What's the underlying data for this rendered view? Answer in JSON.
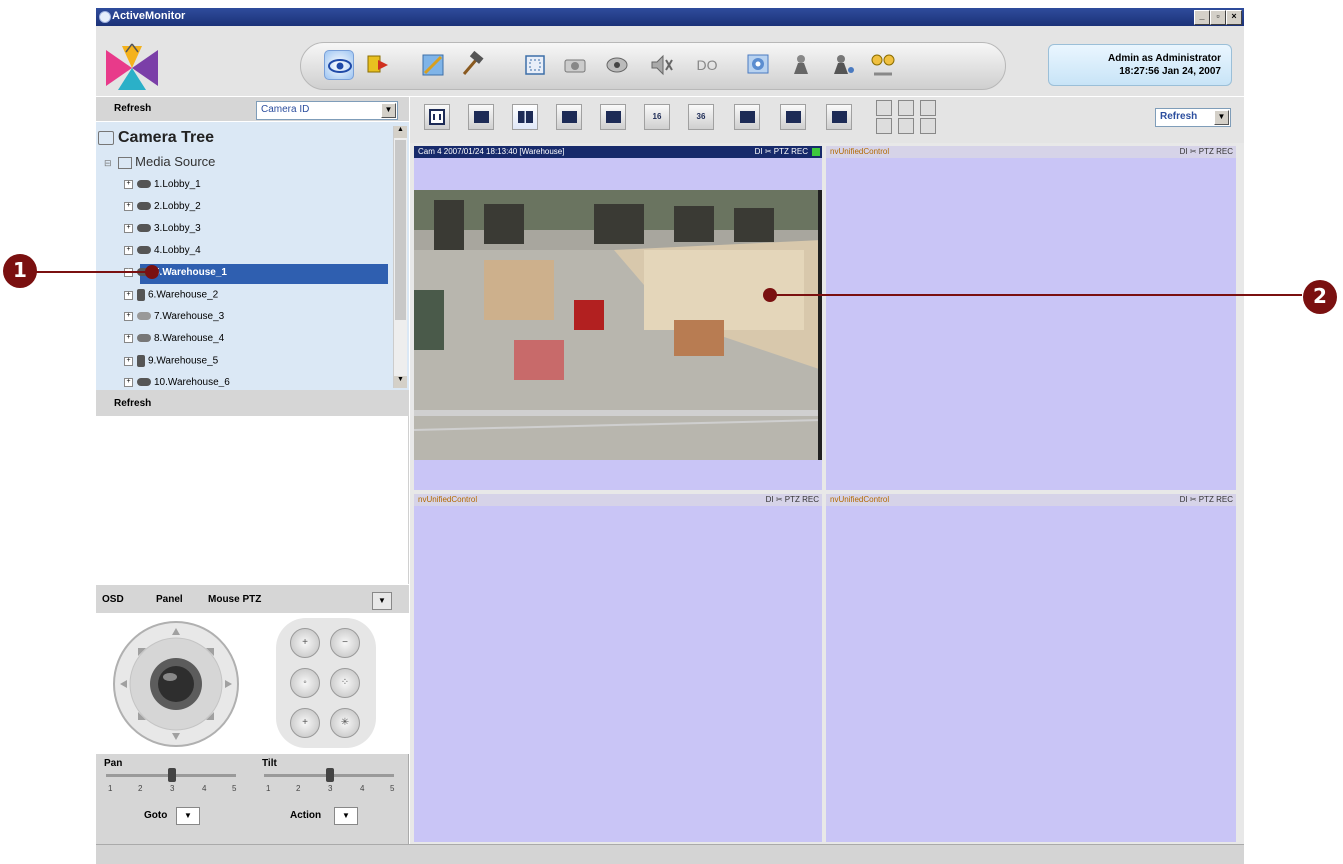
{
  "window": {
    "title": "ActiveMonitor",
    "controls": [
      "_",
      "▫",
      "×"
    ]
  },
  "user": {
    "line1": "Admin as Administrator",
    "line2": "18:27:56 Jan 24, 2007"
  },
  "toolbar": {
    "do_label": "DO"
  },
  "left_panel": {
    "refresh_top": "Refresh",
    "sort_select": "Camera ID",
    "tree_title": "Camera Tree",
    "media_source": "Media Source",
    "cameras": [
      "1.Lobby_1",
      "2.Lobby_2",
      "3.Lobby_3",
      "4.Lobby_4",
      "5.Warehouse_1",
      "6.Warehouse_2",
      "7.Warehouse_3",
      "8.Warehouse_4",
      "9.Warehouse_5",
      "10.Warehouse_6"
    ],
    "selected_camera": "5.Warehouse_1",
    "refresh_bottom": "Refresh"
  },
  "ptz": {
    "tabs": [
      "OSD",
      "Panel",
      "Mouse PTZ"
    ],
    "pan_label": "Pan",
    "tilt_label": "Tilt",
    "scale": [
      "1",
      "2",
      "3",
      "4",
      "5"
    ],
    "goto_label": "Goto",
    "action_label": "Action"
  },
  "view_toolbar": {
    "refresh_select": "Refresh",
    "layout_16": "16",
    "layout_36": "36"
  },
  "cells": [
    {
      "header": "Cam 4 2007/01/24 18:13:40 [Warehouse]",
      "status": "DI ✂ PTZ REC"
    },
    {
      "header": "nvUnifiedControl",
      "status": "DI ✂ PTZ REC"
    },
    {
      "header": "nvUnifiedControl",
      "status": "DI ✂ PTZ REC"
    },
    {
      "header": "nvUnifiedControl",
      "status": "DI ✂ PTZ REC"
    }
  ],
  "callouts": [
    "1",
    "2"
  ],
  "colors": {
    "selection": "#2f5fb0",
    "cell_bg": "#c9c5f6",
    "callout": "#7a1010"
  }
}
